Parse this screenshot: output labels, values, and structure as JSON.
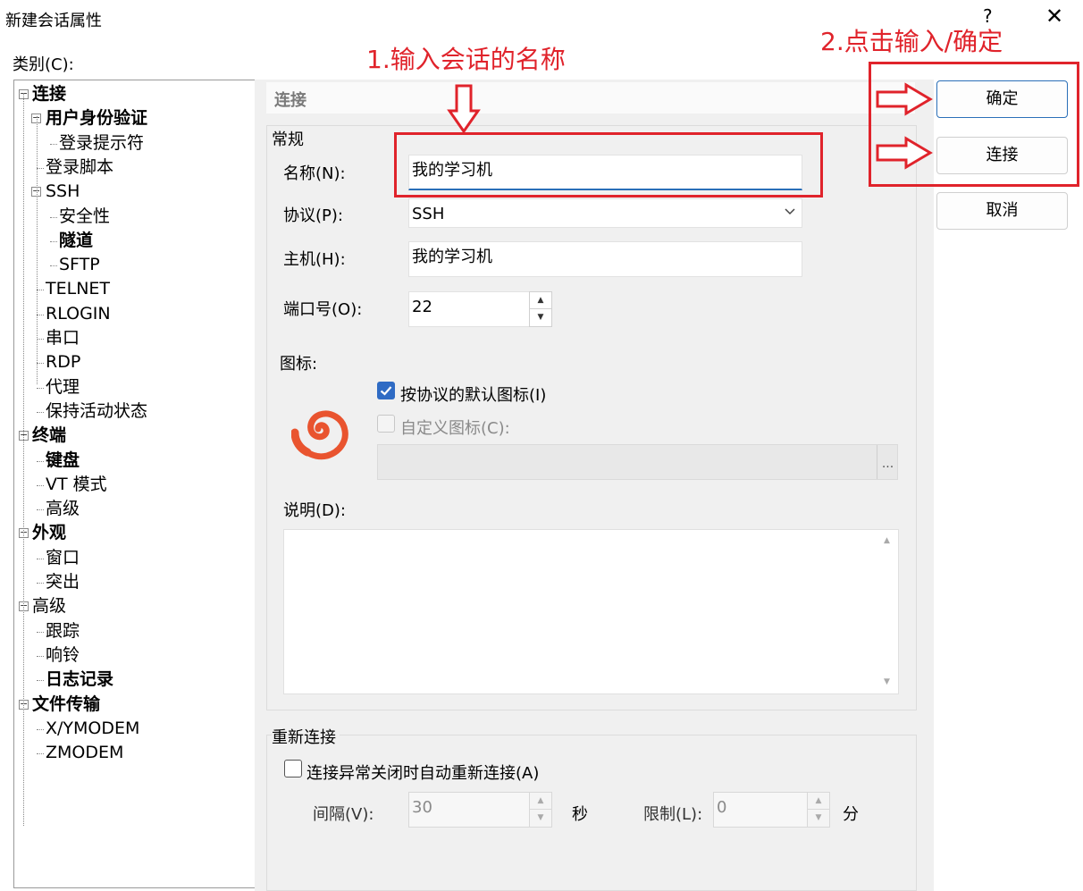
{
  "window": {
    "title": "新建会话属性",
    "help": "?",
    "close": "✕"
  },
  "category_label": "类别(C):",
  "tree": [
    {
      "label": "连接",
      "bold": true,
      "level": 0,
      "toggle": "−"
    },
    {
      "label": "用户身份验证",
      "bold": true,
      "level": 1,
      "toggle": "−"
    },
    {
      "label": "登录提示符",
      "bold": false,
      "level": 2
    },
    {
      "label": "登录脚本",
      "bold": false,
      "level": 1
    },
    {
      "label": "SSH",
      "bold": false,
      "level": 1,
      "toggle": "−"
    },
    {
      "label": "安全性",
      "bold": false,
      "level": 2
    },
    {
      "label": "隧道",
      "bold": true,
      "level": 2
    },
    {
      "label": "SFTP",
      "bold": false,
      "level": 2
    },
    {
      "label": "TELNET",
      "bold": false,
      "level": 1
    },
    {
      "label": "RLOGIN",
      "bold": false,
      "level": 1
    },
    {
      "label": "串口",
      "bold": false,
      "level": 1
    },
    {
      "label": "RDP",
      "bold": false,
      "level": 1
    },
    {
      "label": "代理",
      "bold": false,
      "level": 1
    },
    {
      "label": "保持活动状态",
      "bold": false,
      "level": 1
    },
    {
      "label": "终端",
      "bold": true,
      "level": 0,
      "toggle": "−"
    },
    {
      "label": "键盘",
      "bold": true,
      "level": 1
    },
    {
      "label": "VT 模式",
      "bold": false,
      "level": 1
    },
    {
      "label": "高级",
      "bold": false,
      "level": 1
    },
    {
      "label": "外观",
      "bold": true,
      "level": 0,
      "toggle": "−"
    },
    {
      "label": "窗口",
      "bold": false,
      "level": 1
    },
    {
      "label": "突出",
      "bold": false,
      "level": 1
    },
    {
      "label": "高级",
      "bold": false,
      "level": 0,
      "toggle": "−"
    },
    {
      "label": "跟踪",
      "bold": false,
      "level": 1
    },
    {
      "label": "响铃",
      "bold": false,
      "level": 1
    },
    {
      "label": "日志记录",
      "bold": true,
      "level": 1
    },
    {
      "label": "文件传输",
      "bold": true,
      "level": 0,
      "toggle": "−"
    },
    {
      "label": "X/YMODEM",
      "bold": false,
      "level": 1
    },
    {
      "label": "ZMODEM",
      "bold": false,
      "level": 1
    }
  ],
  "section_header": "连接",
  "general": {
    "group_label": "常规",
    "name_label": "名称(N):",
    "name_value": "我的学习机",
    "protocol_label": "协议(P):",
    "protocol_value": "SSH",
    "host_label": "主机(H):",
    "host_value": "我的学习机",
    "port_label": "端口号(O):",
    "port_value": "22",
    "icon_label": "图标:",
    "default_icon_label": "按协议的默认图标(I)",
    "default_icon_checked": true,
    "custom_icon_label": "自定义图标(C):",
    "custom_icon_checked": false,
    "browse": "...",
    "desc_label": "说明(D):"
  },
  "reconnect": {
    "group_label": "重新连接",
    "auto_label": "连接异常关闭时自动重新连接(A)",
    "auto_checked": false,
    "interval_label": "间隔(V):",
    "interval_value": "30",
    "interval_unit": "秒",
    "limit_label": "限制(L):",
    "limit_value": "0",
    "limit_unit": "分"
  },
  "buttons": {
    "ok": "确定",
    "connect": "连接",
    "cancel": "取消"
  },
  "annotations": {
    "step1": "1.输入会话的名称",
    "step2": "2.点击输入/确定",
    "color": "#e0232b"
  },
  "colors": {
    "accent": "#2a6fb8",
    "checkbox": "#2f6bc4",
    "logo": "#e9542f"
  },
  "icons": {
    "logo": "xshell-spiral-logo-icon",
    "dropdown": "chevron-down-icon",
    "spin_up": "spin-up-icon",
    "spin_down": "spin-down-icon",
    "check": "checkmark-icon"
  }
}
